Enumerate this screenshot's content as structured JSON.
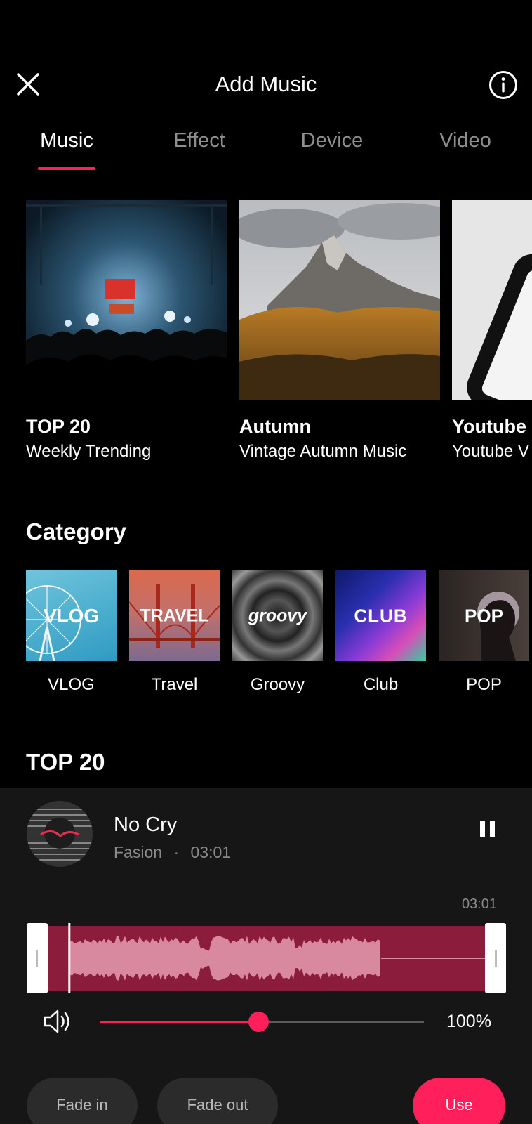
{
  "header": {
    "title": "Add Music",
    "close_icon": "close-icon",
    "info_icon": "info-icon"
  },
  "tabs": [
    {
      "label": "Music",
      "active": true
    },
    {
      "label": "Effect",
      "active": false
    },
    {
      "label": "Device",
      "active": false
    },
    {
      "label": "Video",
      "active": false
    }
  ],
  "featured": [
    {
      "title": "TOP 20",
      "subtitle": "Weekly Trending"
    },
    {
      "title": "Autumn",
      "subtitle": "Vintage Autumn Music"
    },
    {
      "title": "Youtube",
      "subtitle": "Youtube V"
    }
  ],
  "category_section": {
    "title": "Category"
  },
  "categories": [
    {
      "label": "VLOG",
      "tile_text": "VLOG"
    },
    {
      "label": "Travel",
      "tile_text": "TRAVEL"
    },
    {
      "label": "Groovy",
      "tile_text": "groovy"
    },
    {
      "label": "Club",
      "tile_text": "CLUB"
    },
    {
      "label": "POP",
      "tile_text": "POP"
    }
  ],
  "top20_section": {
    "title": "TOP 20"
  },
  "player": {
    "track_title": "No Cry",
    "artist": "Fasion",
    "separator": "·",
    "duration": "03:01",
    "time_end": "03:01",
    "volume_percent": "100%",
    "volume_level": 0.49,
    "playhead_fraction": 0.05,
    "pause_icon": "pause-icon",
    "volume_icon": "speaker-icon"
  },
  "actions": {
    "fade_in": "Fade in",
    "fade_out": "Fade out",
    "use": "Use"
  },
  "colors": {
    "accent": "#ff1f5a",
    "background": "#000000",
    "panel": "#161616",
    "waveform_bg": "#8c1c3c",
    "waveform_fg": "#d9899f"
  }
}
